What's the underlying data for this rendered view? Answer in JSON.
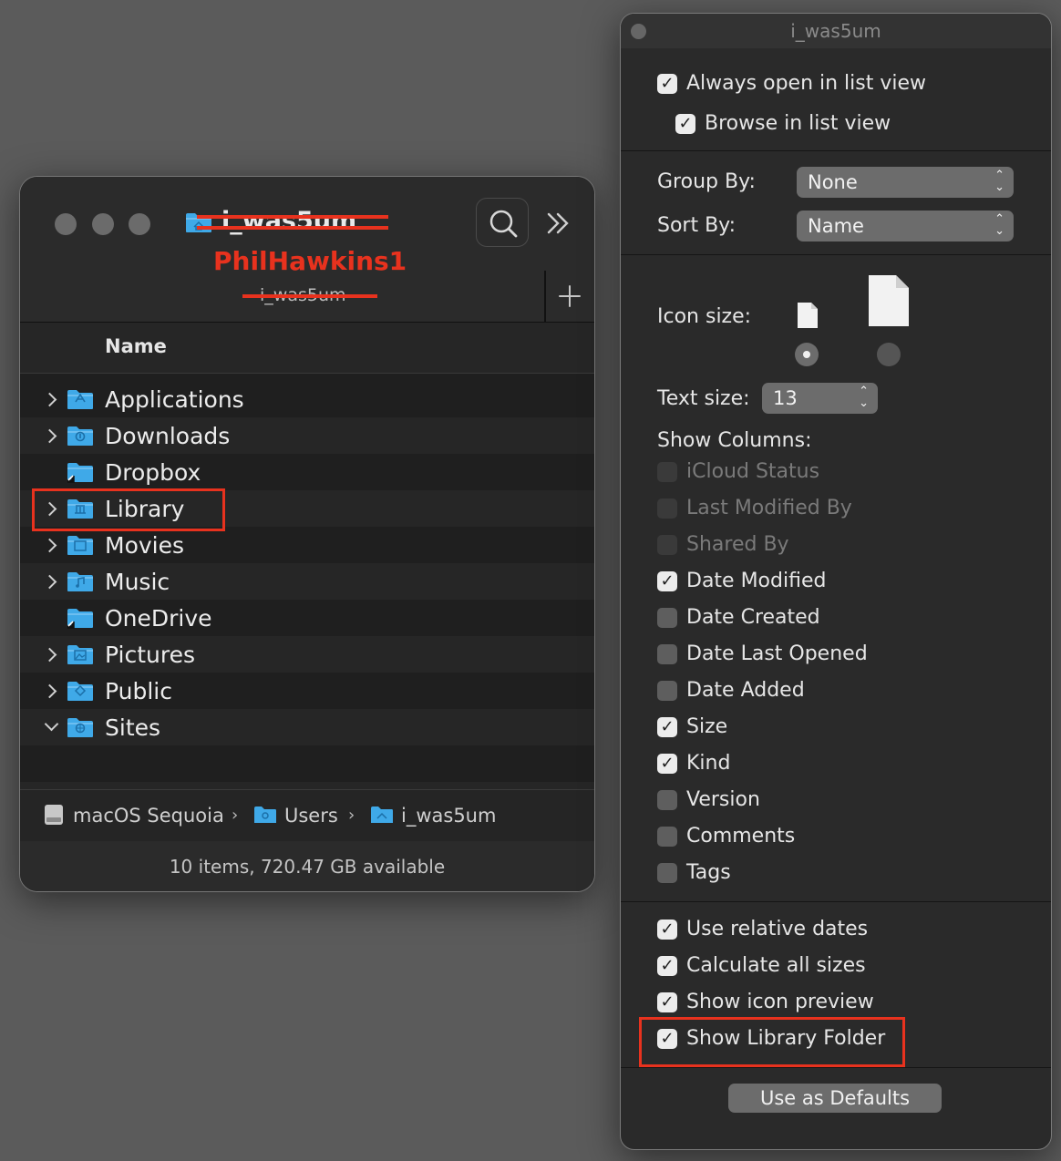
{
  "finder": {
    "title": "i_was5um",
    "annotation_name": "PhilHawkins1",
    "subtitle": "i_was5um",
    "column_header": "Name",
    "items": [
      {
        "name": "Applications",
        "expandable": true,
        "expanded": false,
        "icon": "applications-folder-icon"
      },
      {
        "name": "Downloads",
        "expandable": true,
        "expanded": false,
        "icon": "downloads-folder-icon"
      },
      {
        "name": "Dropbox",
        "expandable": false,
        "expanded": false,
        "icon": "alias-folder-icon"
      },
      {
        "name": "Library",
        "expandable": true,
        "expanded": false,
        "icon": "library-folder-icon"
      },
      {
        "name": "Movies",
        "expandable": true,
        "expanded": false,
        "icon": "movies-folder-icon"
      },
      {
        "name": "Music",
        "expandable": true,
        "expanded": false,
        "icon": "music-folder-icon"
      },
      {
        "name": "OneDrive",
        "expandable": false,
        "expanded": false,
        "icon": "alias-folder-icon"
      },
      {
        "name": "Pictures",
        "expandable": true,
        "expanded": false,
        "icon": "pictures-folder-icon"
      },
      {
        "name": "Public",
        "expandable": true,
        "expanded": false,
        "icon": "public-folder-icon"
      },
      {
        "name": "Sites",
        "expandable": true,
        "expanded": true,
        "icon": "sites-folder-icon"
      }
    ],
    "path_bar": [
      "macOS Sequoia",
      "Users",
      "i_was5um"
    ],
    "status": "10 items, 720.47 GB available"
  },
  "view_options": {
    "title": "i_was5um",
    "always_open_list": {
      "label": "Always open in list view",
      "checked": true
    },
    "browse_list": {
      "label": "Browse in list view",
      "checked": true
    },
    "group_by": {
      "label": "Group By:",
      "value": "None"
    },
    "sort_by": {
      "label": "Sort By:",
      "value": "Name"
    },
    "icon_size_label": "Icon size:",
    "text_size": {
      "label": "Text size:",
      "value": "13"
    },
    "show_columns_label": "Show Columns:",
    "columns": [
      {
        "label": "iCloud Status",
        "checked": false,
        "enabled": false
      },
      {
        "label": "Last Modified By",
        "checked": false,
        "enabled": false
      },
      {
        "label": "Shared By",
        "checked": false,
        "enabled": false
      },
      {
        "label": "Date Modified",
        "checked": true,
        "enabled": true
      },
      {
        "label": "Date Created",
        "checked": false,
        "enabled": true
      },
      {
        "label": "Date Last Opened",
        "checked": false,
        "enabled": true
      },
      {
        "label": "Date Added",
        "checked": false,
        "enabled": true
      },
      {
        "label": "Size",
        "checked": true,
        "enabled": true
      },
      {
        "label": "Kind",
        "checked": true,
        "enabled": true
      },
      {
        "label": "Version",
        "checked": false,
        "enabled": true
      },
      {
        "label": "Comments",
        "checked": false,
        "enabled": true
      },
      {
        "label": "Tags",
        "checked": false,
        "enabled": true
      }
    ],
    "options": [
      {
        "label": "Use relative dates",
        "checked": true
      },
      {
        "label": "Calculate all sizes",
        "checked": true
      },
      {
        "label": "Show icon preview",
        "checked": true
      },
      {
        "label": "Show Library Folder",
        "checked": true
      }
    ],
    "defaults_button": "Use as Defaults"
  },
  "colors": {
    "folder_blue": "#3fa9e8",
    "annotation_red": "#e8321e",
    "window_bg": "#1e1e1e",
    "desktop_bg": "#5b5b5b"
  }
}
